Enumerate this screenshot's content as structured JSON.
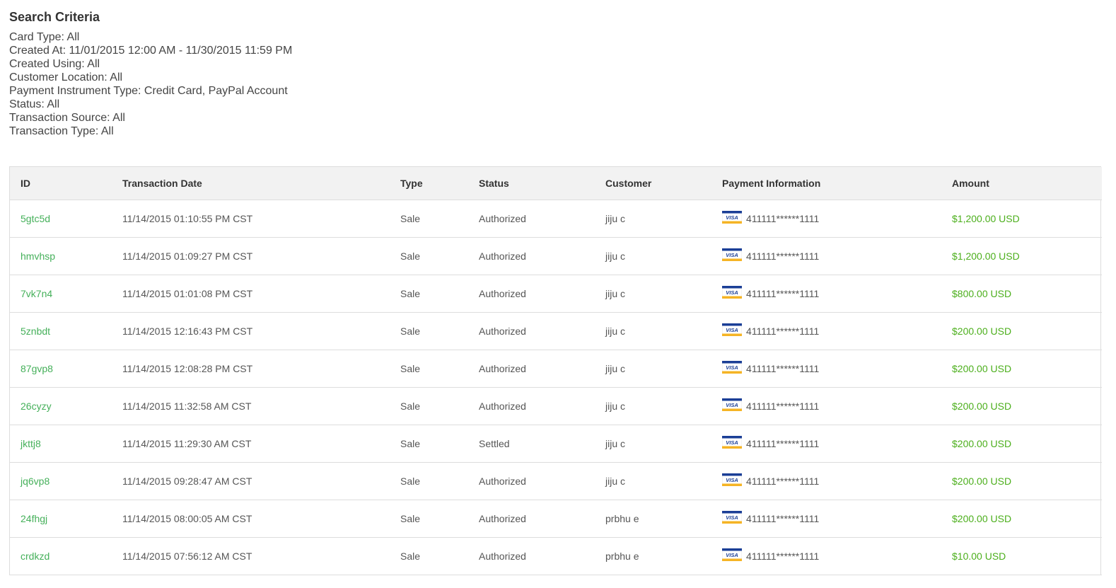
{
  "search_criteria": {
    "title": "Search Criteria",
    "lines": [
      "Card Type: All",
      "Created At: 11/01/2015 12:00 AM - 11/30/2015 11:59 PM",
      "Created Using: All",
      "Customer Location: All",
      "Payment Instrument Type: Credit Card, PayPal Account",
      "Status: All",
      "Transaction Source: All",
      "Transaction Type: All"
    ]
  },
  "table": {
    "headers": {
      "id": "ID",
      "date": "Transaction Date",
      "type": "Type",
      "status": "Status",
      "customer": "Customer",
      "payment": "Payment Information",
      "amount": "Amount"
    },
    "rows": [
      {
        "id": "5gtc5d",
        "date": "11/14/2015 01:10:55 PM CST",
        "type": "Sale",
        "status": "Authorized",
        "customer": "jiju c",
        "card_icon": "visa-card-icon",
        "card": "411111******1111",
        "amount": "$1,200.00 USD"
      },
      {
        "id": "hmvhsp",
        "date": "11/14/2015 01:09:27 PM CST",
        "type": "Sale",
        "status": "Authorized",
        "customer": "jiju c",
        "card_icon": "visa-card-icon",
        "card": "411111******1111",
        "amount": "$1,200.00 USD"
      },
      {
        "id": "7vk7n4",
        "date": "11/14/2015 01:01:08 PM CST",
        "type": "Sale",
        "status": "Authorized",
        "customer": "jiju c",
        "card_icon": "visa-card-icon",
        "card": "411111******1111",
        "amount": "$800.00 USD"
      },
      {
        "id": "5znbdt",
        "date": "11/14/2015 12:16:43 PM CST",
        "type": "Sale",
        "status": "Authorized",
        "customer": "jiju c",
        "card_icon": "visa-card-icon",
        "card": "411111******1111",
        "amount": "$200.00 USD"
      },
      {
        "id": "87gvp8",
        "date": "11/14/2015 12:08:28 PM CST",
        "type": "Sale",
        "status": "Authorized",
        "customer": "jiju c",
        "card_icon": "visa-card-icon",
        "card": "411111******1111",
        "amount": "$200.00 USD"
      },
      {
        "id": "26cyzy",
        "date": "11/14/2015 11:32:58 AM CST",
        "type": "Sale",
        "status": "Authorized",
        "customer": "jiju c",
        "card_icon": "visa-card-icon",
        "card": "411111******1111",
        "amount": "$200.00 USD"
      },
      {
        "id": "jkttj8",
        "date": "11/14/2015 11:29:30 AM CST",
        "type": "Sale",
        "status": "Settled",
        "customer": "jiju c",
        "card_icon": "visa-card-icon",
        "card": "411111******1111",
        "amount": "$200.00 USD"
      },
      {
        "id": "jq6vp8",
        "date": "11/14/2015 09:28:47 AM CST",
        "type": "Sale",
        "status": "Authorized",
        "customer": "jiju c",
        "card_icon": "visa-card-icon",
        "card": "411111******1111",
        "amount": "$200.00 USD"
      },
      {
        "id": "24fhgj",
        "date": "11/14/2015 08:00:05 AM CST",
        "type": "Sale",
        "status": "Authorized",
        "customer": "prbhu e",
        "card_icon": "visa-card-icon",
        "card": "411111******1111",
        "amount": "$200.00 USD"
      },
      {
        "id": "crdkzd",
        "date": "11/14/2015 07:56:12 AM CST",
        "type": "Sale",
        "status": "Authorized",
        "customer": "prbhu e",
        "card_icon": "visa-card-icon",
        "card": "411111******1111",
        "amount": "$10.00 USD"
      }
    ]
  },
  "colors": {
    "link": "#45b05a",
    "amount": "#4caf1c",
    "header_bg": "#f2f2f2",
    "border": "#dddddd",
    "visa_blue": "#1a3e96",
    "visa_gold": "#f5b425"
  }
}
